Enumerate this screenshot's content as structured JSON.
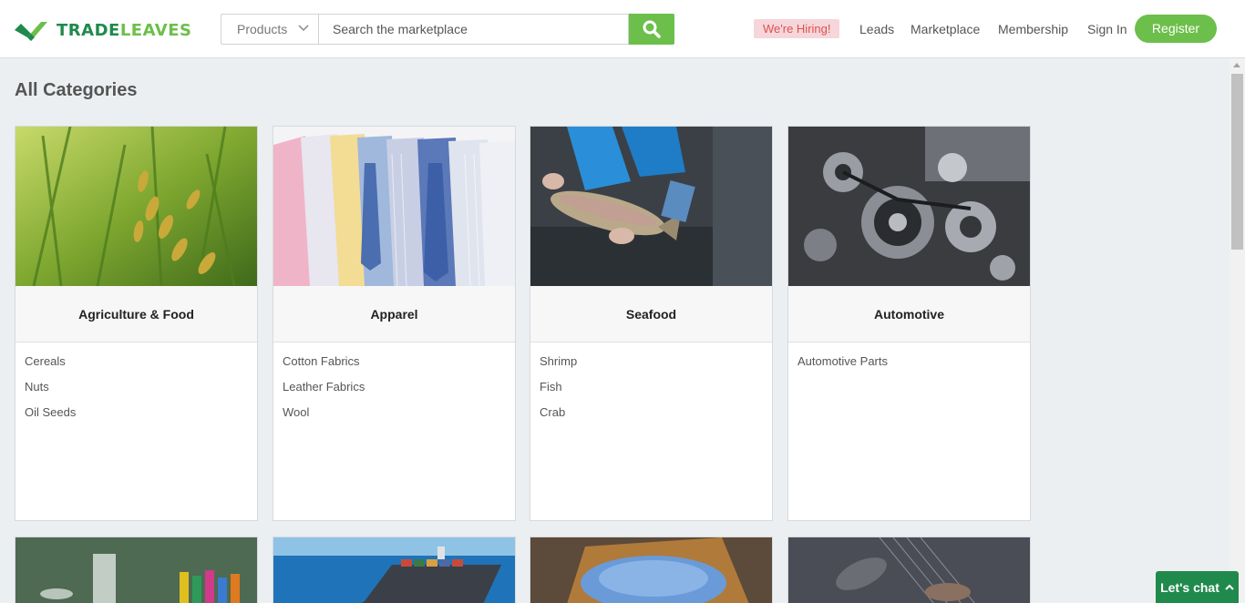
{
  "brand": {
    "name_part1": "TRADE",
    "name_part2": "LEAVES"
  },
  "search": {
    "category": "Products",
    "placeholder": "Search the marketplace"
  },
  "nav": {
    "hiring": "We're Hiring!",
    "leads": "Leads",
    "marketplace": "Marketplace",
    "membership": "Membership",
    "sign_in": "Sign In",
    "register": "Register"
  },
  "page": {
    "title": "All Categories"
  },
  "categories": [
    {
      "name": "Agriculture & Food",
      "subs": [
        "Cereals",
        "Nuts",
        "Oil Seeds"
      ]
    },
    {
      "name": "Apparel",
      "subs": [
        "Cotton Fabrics",
        "Leather Fabrics",
        "Wool"
      ]
    },
    {
      "name": "Seafood",
      "subs": [
        "Shrimp",
        "Fish",
        "Crab"
      ]
    },
    {
      "name": "Automotive",
      "subs": [
        "Automotive Parts"
      ]
    }
  ],
  "chat": {
    "label": "Let's chat"
  },
  "colors": {
    "brand_dark_green": "#1f8a4c",
    "brand_light_green": "#6cbf4a",
    "hiring_bg": "#f6d6da",
    "hiring_text": "#d9534f"
  }
}
